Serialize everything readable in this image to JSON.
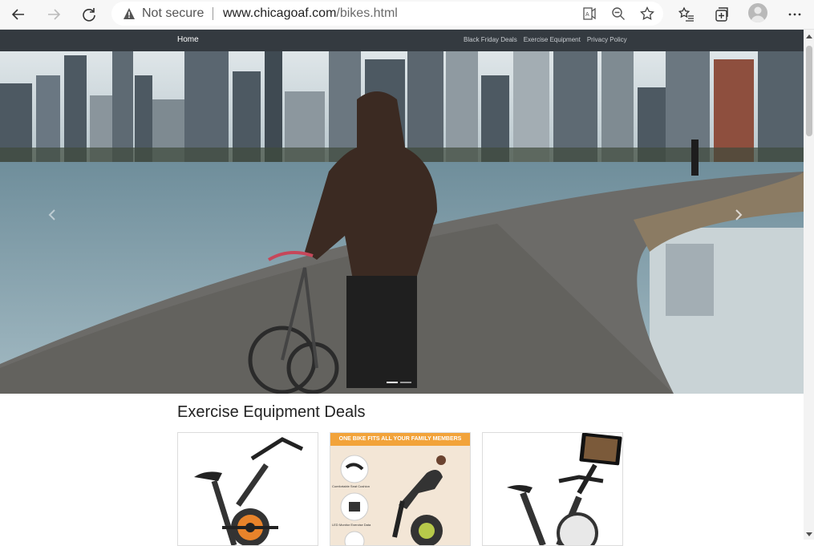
{
  "browser": {
    "security_label": "Not secure",
    "url_host": "www.chicagoaf.com",
    "url_path": "/bikes.html"
  },
  "site_nav": {
    "home": "Home",
    "links": [
      "Black Friday Deals",
      "Exercise Equipment",
      "Privacy Policy"
    ]
  },
  "carousel": {
    "slide_count": 2,
    "active_index": 0
  },
  "section": {
    "title": "Exercise Equipment Deals"
  },
  "products": [
    {
      "banner": ""
    },
    {
      "banner": "ONE BIKE FITS ALL YOUR FAMILY MEMBERS",
      "feature_labels": [
        "Comfortable Seat Cushion",
        "LED Monitor Exercise Data"
      ]
    },
    {
      "banner": ""
    }
  ],
  "colors": {
    "nav_bg": "#343a40",
    "chrome_bg": "#f7f7f7",
    "banner_orange": "#f2a33a"
  }
}
